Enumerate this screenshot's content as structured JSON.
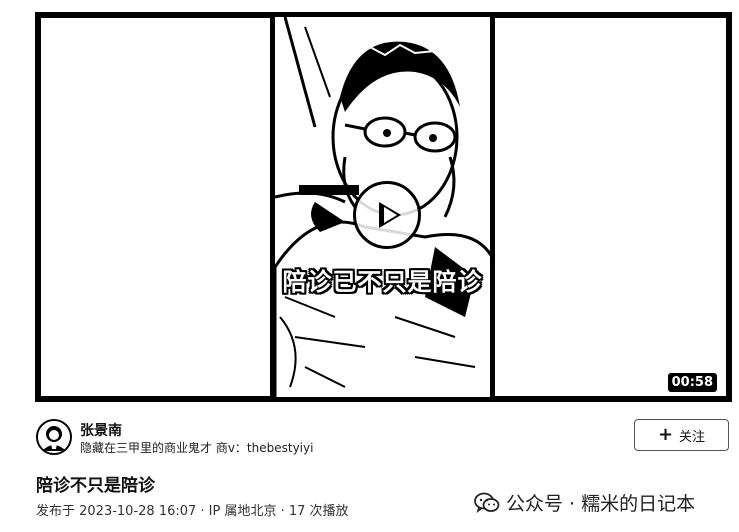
{
  "video": {
    "caption": "陪诊已不只是陪诊",
    "duration": "00:58",
    "play_icon": "play-icon"
  },
  "author": {
    "name": "张景南",
    "bio": "隐藏在三甲里的商业鬼才 商v：thebestyiyi",
    "avatar_icon": "avatar"
  },
  "follow": {
    "icon": "plus-icon",
    "plus": "+",
    "label": "关注"
  },
  "post": {
    "title": "陪诊不只是陪诊",
    "meta": "发布于 2023-10-28 16:07 · IP 属地北京 · 17 次播放"
  },
  "watermark": {
    "icon": "wechat-icon",
    "text": "公众号 · 糯米的日记本"
  }
}
